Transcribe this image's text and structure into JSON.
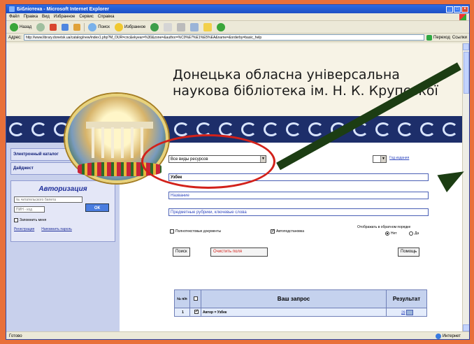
{
  "window": {
    "title": "Бібліотека - Microsoft Internet Explorer",
    "controls": [
      "_",
      "□",
      "×"
    ]
  },
  "menubar": [
    "Файл",
    "Правка",
    "Вид",
    "Избранное",
    "Сервис",
    "Справка"
  ],
  "toolbar": {
    "back": "Назад",
    "search": "Поиск",
    "favorites": "Избранное"
  },
  "address": {
    "label": "Адрес:",
    "url": "http://www.library.donetsk.ua/catalog/new/index1.php?M_OUR=cnc&ekyear=%30&zone=&author=%C0%E7%E1%E5%EA&name=&orderby=basic_help",
    "go": "Переход",
    "links": "Ссылки"
  },
  "header": {
    "title_line1": "Донецька обласна універсальна",
    "title_line2": "наукова бібліотека ім. Н. К. Крупської"
  },
  "sidebar": {
    "items": [
      {
        "label": "Электронный каталог"
      },
      {
        "label": "Дайджест"
      }
    ],
    "auth": {
      "title": "Авторизация",
      "card_placeholder": "№ читательского билета",
      "pin_placeholder": "ПИН - код",
      "ok": "ОК",
      "remember": "Запомнить меня",
      "register": "Регистрация",
      "forgot": "Напомнить пароль"
    }
  },
  "search": {
    "resource_type": "Все виды ресурсов",
    "year_label": "Год издания",
    "author_value": "Узбек",
    "title_placeholder": "Название",
    "subject_placeholder": "Предметные рубрики, ключевые слова",
    "fulltext_label": "Полнотекстовые документы",
    "autosubst_label": "Автоподстановка",
    "sort_label": "Отображать в обратном порядке",
    "radio_no": "Нет",
    "radio_yes": "Да",
    "search_button": "Поиск",
    "clear_button": "Очистить поля",
    "help_button": "Помощь"
  },
  "results": {
    "headers": [
      "№ п/п",
      "",
      "Ваш запрос",
      "Результат"
    ],
    "rows": [
      {
        "num": "1",
        "query": "Автор = Узбек",
        "count": "29"
      }
    ]
  },
  "status": {
    "left": "Готово",
    "zone": "Интернет"
  },
  "colors": {
    "frame": "#e8703a",
    "ornament": "#1d2e6a",
    "highlight_circle": "#d2211a",
    "arrow": "#1c3d13",
    "sidebar": "#c8d0ec"
  }
}
